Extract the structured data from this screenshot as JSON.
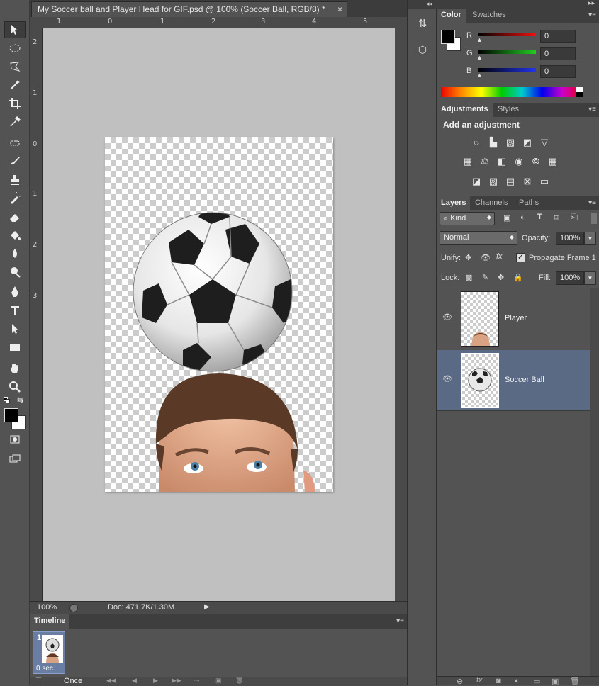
{
  "document": {
    "tab_title": "My Soccer ball and Player Head for GIF.psd @ 100% (Soccer Ball, RGB/8) *",
    "close_glyph": "×",
    "ruler_top": [
      "1",
      "0",
      "1",
      "2",
      "3",
      "4",
      "5"
    ],
    "ruler_left": [
      "2",
      "1",
      "0",
      "1",
      "2",
      "3"
    ],
    "zoom": "100%",
    "doc_size": "Doc: 471.7K/1.30M"
  },
  "timeline": {
    "title": "Timeline",
    "frame_number": "1",
    "frame_delay": "0 sec.",
    "loop": "Once"
  },
  "color_panel": {
    "tabs": [
      "Color",
      "Swatches"
    ],
    "channels": [
      {
        "label": "R",
        "value": "0",
        "color": "#d42020"
      },
      {
        "label": "G",
        "value": "0",
        "color": "#22c022"
      },
      {
        "label": "B",
        "value": "0",
        "color": "#2030d8"
      }
    ]
  },
  "adjustments_panel": {
    "tabs": [
      "Adjustments",
      "Styles"
    ],
    "heading": "Add an adjustment"
  },
  "layers_panel": {
    "tabs": [
      "Layers",
      "Channels",
      "Paths"
    ],
    "filter_kind": "Kind",
    "blend_mode": "Normal",
    "opacity_label": "Opacity:",
    "opacity_value": "100%",
    "unify_label": "Unify:",
    "propagate_label": "Propagate Frame 1",
    "lock_label": "Lock:",
    "fill_label": "Fill:",
    "fill_value": "100%",
    "layers": [
      {
        "name": "Player",
        "selected": false
      },
      {
        "name": "Soccer Ball",
        "selected": true
      }
    ]
  },
  "colors": {
    "selected_layer_bg": "#5a6a84",
    "panel_bg": "#535353"
  }
}
